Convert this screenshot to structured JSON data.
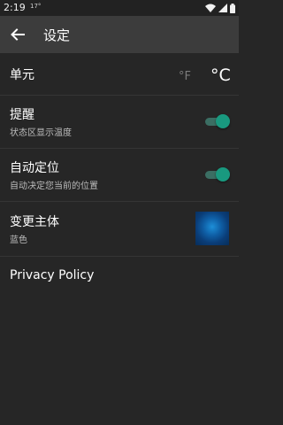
{
  "status_bar": {
    "time": "2:19",
    "temperature": "17°",
    "icons": [
      "wifi-icon",
      "signal-icon",
      "battery-icon"
    ]
  },
  "app_bar": {
    "title": "设定",
    "back_icon": "arrow-left-icon"
  },
  "settings": {
    "unit": {
      "title": "单元",
      "option_f": "°F",
      "option_c": "°C",
      "selected": "°C"
    },
    "reminder": {
      "title": "提醒",
      "subtitle": "状态区显示温度",
      "enabled": true
    },
    "auto_location": {
      "title": "自动定位",
      "subtitle": "自动决定您当前的位置",
      "enabled": true
    },
    "theme": {
      "title": "变更主体",
      "subtitle": "蓝色",
      "swatch_color": "#0f5fa6"
    },
    "privacy": {
      "label": "Privacy Policy"
    }
  },
  "colors": {
    "background": "#262626",
    "app_bar": "#3c3c3c",
    "accent": "#19997f"
  }
}
